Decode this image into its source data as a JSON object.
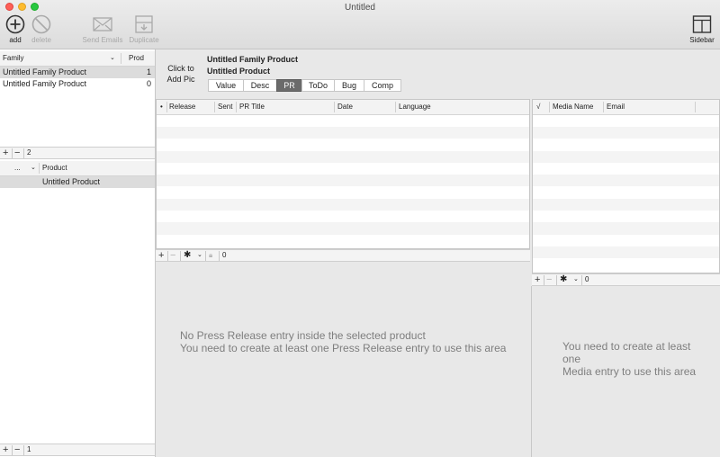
{
  "window": {
    "title": "Untitled"
  },
  "toolbar": {
    "add_label": "add",
    "delete_label": "delete",
    "send_emails_label": "Send Emails",
    "duplicate_label": "Duplicate",
    "sidebar_label": "Sidebar"
  },
  "family_table": {
    "columns": [
      "Family",
      "Prod"
    ],
    "rows": [
      {
        "name": "Untitled Family Product",
        "prod": "1"
      },
      {
        "name": "Untitled Family Product",
        "prod": "0"
      }
    ],
    "count": "2"
  },
  "product_table": {
    "columns": [
      "...",
      "Product"
    ],
    "rows": [
      {
        "name": "Untitled Product"
      }
    ],
    "count": "1"
  },
  "detail": {
    "pic_label": "Click to Add Pic",
    "family_title": "Untitled Family Product",
    "product_title": "Untitled Product"
  },
  "tabs": [
    "Value",
    "Desc",
    "PR",
    "ToDo",
    "Bug",
    "Comp"
  ],
  "selected_tab": "PR",
  "pr_table": {
    "columns": [
      "•",
      "Release",
      "Sent",
      "PR Title",
      "Date",
      "Language"
    ],
    "count": "0",
    "empty_line1": "No Press Release entry inside the selected product",
    "empty_line2": "You need to create at least one Press Release entry to use this area"
  },
  "media_table": {
    "columns": [
      "√",
      "Media Name",
      "Email"
    ],
    "count": "0",
    "empty_line1": "You need to create at least one",
    "empty_line2": "Media entry to use this area"
  }
}
